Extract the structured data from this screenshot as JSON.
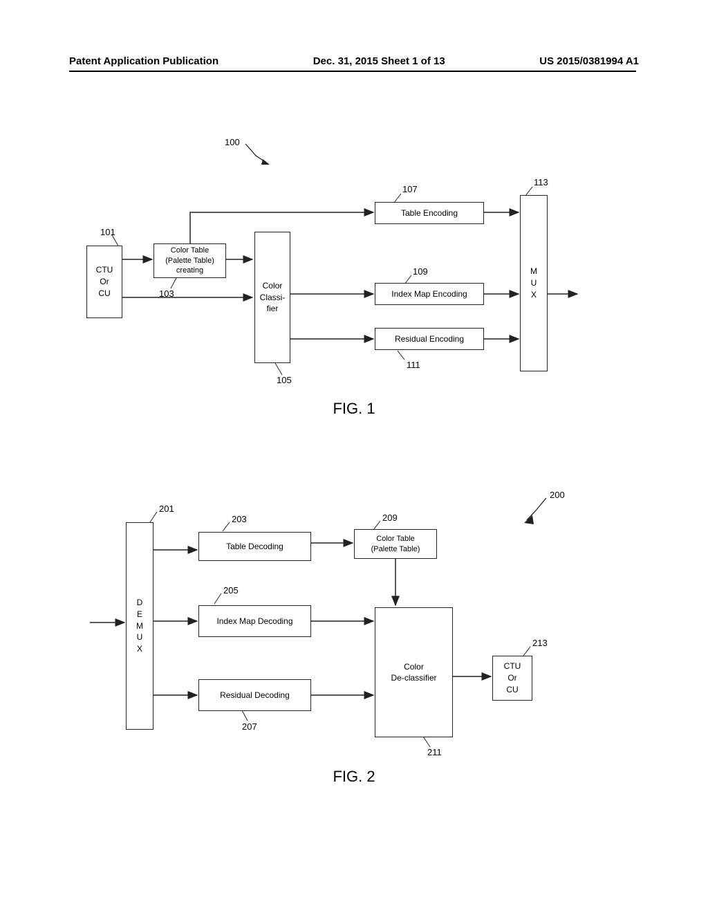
{
  "header": {
    "left": "Patent Application Publication",
    "center": "Dec. 31, 2015  Sheet 1 of 13",
    "right": "US 2015/0381994 A1"
  },
  "fig1": {
    "ref_system": "100",
    "ctu": "CTU\nOr\nCU",
    "color_table_creating": "Color Table\n(Palette Table)\ncreating",
    "color_classifier": "Color\nClassi-\nfier",
    "table_encoding": "Table Encoding",
    "index_map_encoding": "Index Map Encoding",
    "residual_encoding": "Residual Encoding",
    "mux": "M\nU\nX",
    "label_101": "101",
    "label_103": "103",
    "label_105": "105",
    "label_107": "107",
    "label_109": "109",
    "label_111": "111",
    "label_113": "113",
    "caption": "FIG. 1"
  },
  "fig2": {
    "ref_system": "200",
    "demux": "D\nE\nM\nU\nX",
    "table_decoding": "Table Decoding",
    "index_map_decoding": "Index Map Decoding",
    "residual_decoding": "Residual Decoding",
    "color_table": "Color Table\n(Palette Table)",
    "color_declassifier": "Color\nDe-classifier",
    "ctu": "CTU\nOr\nCU",
    "label_201": "201",
    "label_203": "203",
    "label_205": "205",
    "label_207": "207",
    "label_209": "209",
    "label_211": "211",
    "label_213": "213",
    "caption": "FIG. 2"
  }
}
